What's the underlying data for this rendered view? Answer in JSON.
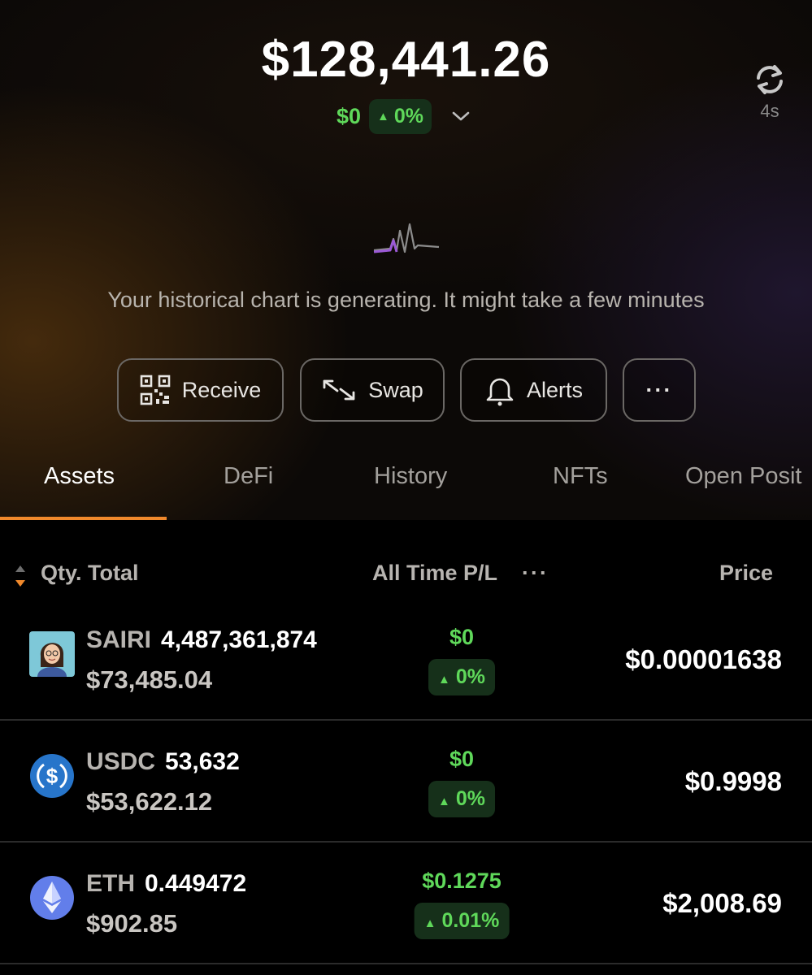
{
  "header": {
    "total_balance": "$128,441.26",
    "change_amount": "$0",
    "change_percent": "0%",
    "refresh_age": "4s"
  },
  "chart_placeholder": {
    "message": "Your historical chart is generating. It might take a few minutes"
  },
  "actions": {
    "receive": "Receive",
    "swap": "Swap",
    "alerts": "Alerts",
    "more": "···"
  },
  "tabs": [
    "Assets",
    "DeFi",
    "History",
    "NFTs",
    "Open Posit"
  ],
  "columns": {
    "qty_total": "Qty. Total",
    "pl": "All Time P/L",
    "pl_more": "···",
    "price": "Price"
  },
  "assets": [
    {
      "symbol": "SAIRI",
      "quantity": "4,487,361,874",
      "value": "$73,485.04",
      "pl_amount": "$0",
      "pl_percent": "0%",
      "price": "$0.00001638",
      "icon": "avatar-icon"
    },
    {
      "symbol": "USDC",
      "quantity": "53,632",
      "value": "$53,622.12",
      "pl_amount": "$0",
      "pl_percent": "0%",
      "price": "$0.9998",
      "icon": "usdc-icon"
    },
    {
      "symbol": "ETH",
      "quantity": "0.449472",
      "value": "$902.85",
      "pl_amount": "$0.1275",
      "pl_percent": "0.01%",
      "price": "$2,008.69",
      "icon": "eth-icon"
    }
  ],
  "colors": {
    "accent": "#f0892c",
    "positive": "#5fd85a",
    "positive_bg": "#16301a",
    "usdc": "#2775ca",
    "eth": "#627eea"
  }
}
